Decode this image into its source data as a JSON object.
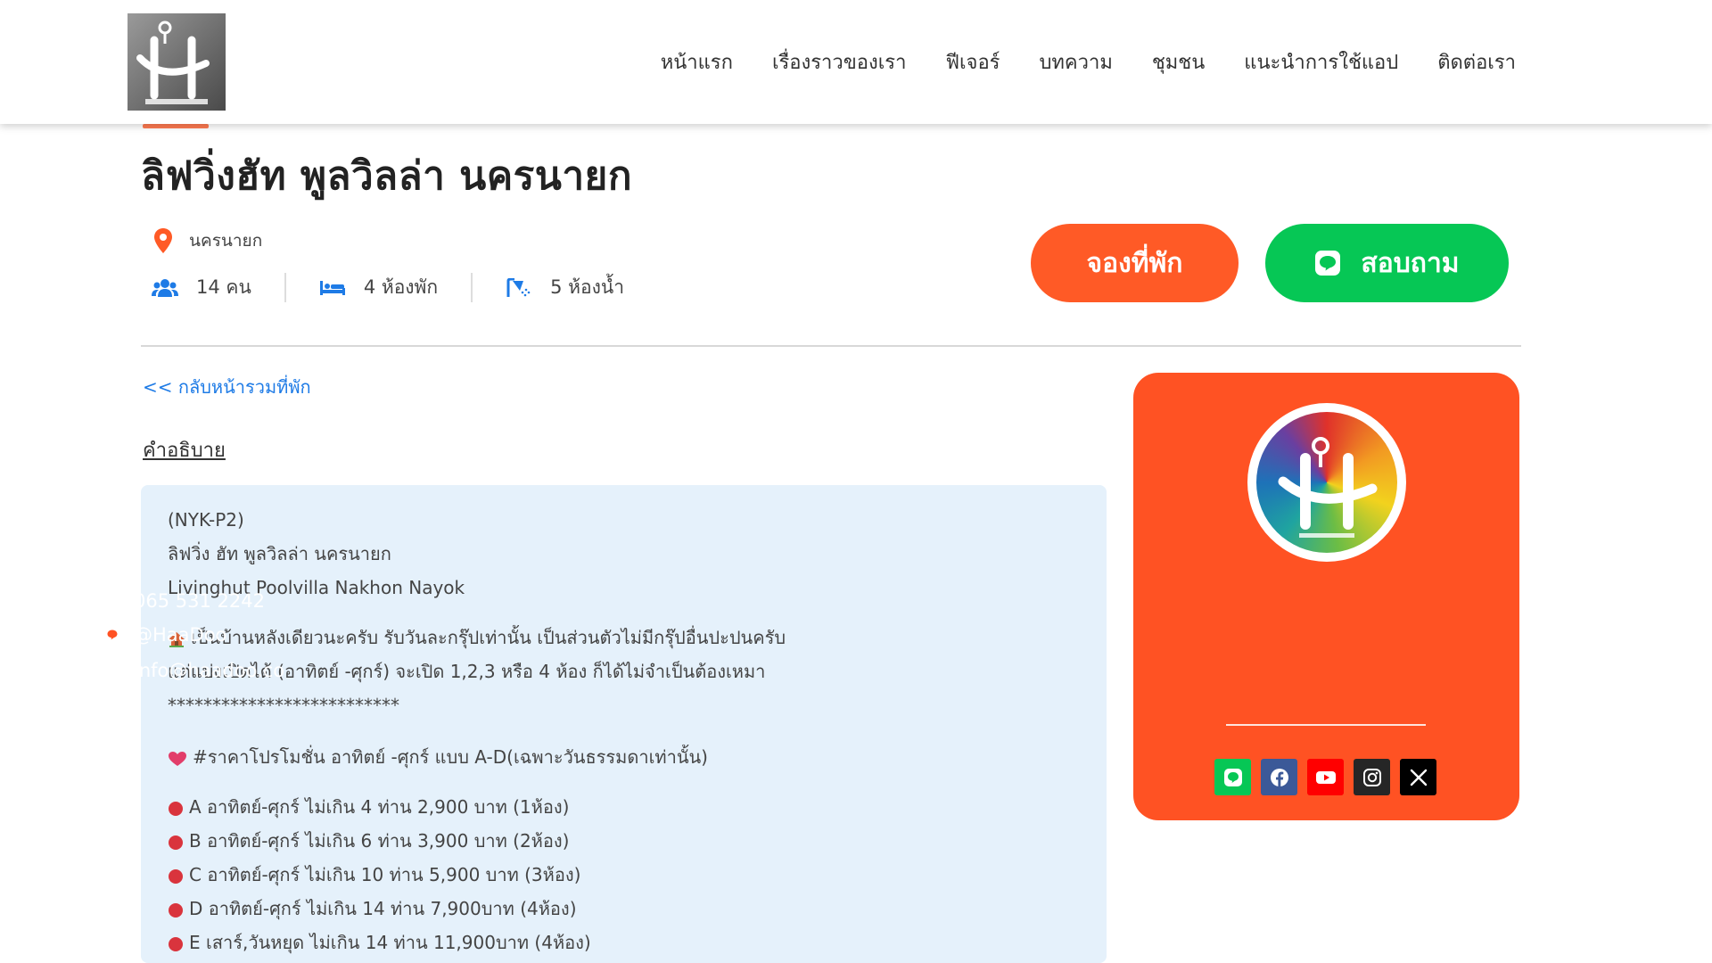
{
  "nav": [
    {
      "label": "หน้าแรก"
    },
    {
      "label": "เรื่องราวของเรา"
    },
    {
      "label": "ฟีเจอร์"
    },
    {
      "label": "บทความ"
    },
    {
      "label": "ชุมชน"
    },
    {
      "label": "แนะนำการใช้แอป"
    },
    {
      "label": "ติดต่อเรา"
    }
  ],
  "listing": {
    "title": "ลิฟวิ่งฮัท พูลวิลล่า นครนายก",
    "location": "นครนายก",
    "guests": "14 คน",
    "bedrooms": "4 ห้องพัก",
    "bathrooms": "5 ห้องน้ำ"
  },
  "buttons": {
    "book": "จองที่พัก",
    "ask": "สอบถาม"
  },
  "back_link": "<< กลับหน้ารวมที่พัก",
  "description": {
    "label": "คำอธิบาย",
    "code": "(NYK-P2)",
    "name_th": "ลิฟวิ่ง ฮัท พูลวิลล่า นครนายก",
    "name_en": "Livinghut Poolvilla Nakhon Nayok",
    "p1": "เป็นบ้านหลังเดียวนะครับ รับวันละกรุ๊ปเท่านั้น เป็นส่วนตัวไม่มีกรุ๊ปอื่นปะปนครับ",
    "p2": "แต่แบ่งเปิดได้ (อาทิตย์ -ศุกร์) จะเปิด 1,2,3 หรือ 4 ห้อง ก็ได้ไม่จำเป็นต้องเหมา",
    "stars": "**************************",
    "promo": "#ราคาโปรโมชั่น อาทิตย์ -ศุกร์ แบบ A-D(เฉพาะวันธรรมดาเท่านั้น)",
    "prices": [
      "A อาทิตย์-ศุกร์ ไม่เกิน 4 ท่าน 2,900 บาท (1ห้อง)",
      "B อาทิตย์-ศุกร์ ไม่เกิน 6 ท่าน 3,900 บาท (2ห้อง)",
      "C อาทิตย์-ศุกร์ ไม่เกิน 10 ท่าน 5,900 บาท (3ห้อง)",
      "D อาทิตย์-ศุกร์ ไม่เกิน 14 ท่าน 7,900บาท (4ห้อง)",
      "E เสาร์,วันหยุด ไม่เกิน 14 ท่าน 11,900บาท (4ห้อง)"
    ]
  },
  "contact": {
    "phone": "065 531 2242",
    "line": "@HaaDoo",
    "email": "info@haadoo.co"
  },
  "colors": {
    "accent_orange": "#ff5a26",
    "line_green": "#06c755",
    "link_blue": "#1e7be6",
    "desc_bg": "#e5f1fb",
    "card_bg": "#ff5223"
  },
  "icons": {
    "location": "map-pin-icon",
    "guests": "users-icon",
    "bedrooms": "bed-icon",
    "bathrooms": "shower-icon",
    "phone": "phone-icon",
    "line": "line-icon",
    "email": "envelope-icon",
    "socials": [
      "line-icon",
      "facebook-icon",
      "youtube-icon",
      "instagram-icon",
      "x-icon"
    ]
  }
}
